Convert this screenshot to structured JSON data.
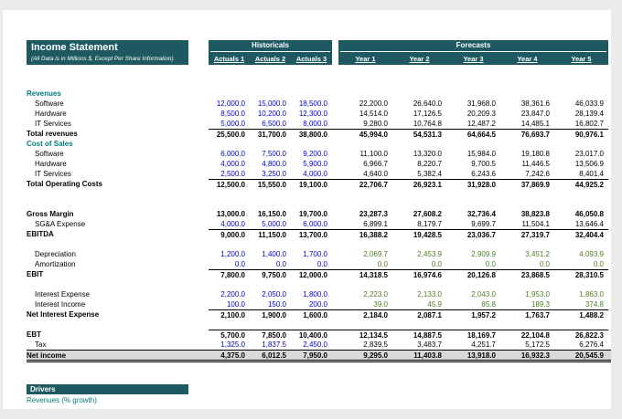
{
  "header": {
    "title": "Income Statement",
    "subtitle": "(All Data is in Millions $, Except Per Share Information)",
    "groups": {
      "historicals": "Historicals",
      "forecasts": "Forecasts"
    },
    "columns": [
      "Actuals 1",
      "Actuals 2",
      "Actuals 3",
      "Year 1",
      "Year 2",
      "Year 3",
      "Year 4",
      "Year 5"
    ]
  },
  "colors": {
    "banner": "#1E5962",
    "section": "#007C7C",
    "blue": "#0000CC",
    "green": "#4A7D23",
    "netbg": "#D9D9D9"
  },
  "table": {
    "rows": [
      {
        "type": "section",
        "label": "Revenues"
      },
      {
        "type": "item",
        "label": "Software",
        "hist": "blue",
        "fcst": "black",
        "values": [
          "12,000.0",
          "15,000.0",
          "18,500.0",
          "22,200.0",
          "26,640.0",
          "31,968.0",
          "38,361.6",
          "46,033.9"
        ]
      },
      {
        "type": "item",
        "label": "Hardware",
        "hist": "blue",
        "fcst": "black",
        "values": [
          "8,500.0",
          "10,200.0",
          "12,300.0",
          "14,514.0",
          "17,126.5",
          "20,209.3",
          "23,847.0",
          "28,139.4"
        ]
      },
      {
        "type": "item",
        "label": "IT Services",
        "hist": "blue",
        "fcst": "black",
        "values": [
          "5,000.0",
          "6,500.0",
          "8,000.0",
          "9,280.0",
          "10,764.8",
          "12,487.2",
          "14,485.1",
          "16,802.7"
        ]
      },
      {
        "type": "total",
        "label": "Total revenues",
        "border": true,
        "hist": "black",
        "fcst": "black",
        "values": [
          "25,500.0",
          "31,700.0",
          "38,800.0",
          "45,994.0",
          "54,531.3",
          "64,664.5",
          "76,693.7",
          "90,976.1"
        ]
      },
      {
        "type": "section",
        "label": "Cost of Sales"
      },
      {
        "type": "item",
        "label": "Software",
        "hist": "blue",
        "fcst": "black",
        "values": [
          "6,000.0",
          "7,500.0",
          "9,200.0",
          "11,100.0",
          "13,320.0",
          "15,984.0",
          "19,180.8",
          "23,017.0"
        ]
      },
      {
        "type": "item",
        "label": "Hardware",
        "hist": "blue",
        "fcst": "black",
        "values": [
          "4,000.0",
          "4,800.0",
          "5,900.0",
          "6,966.7",
          "8,220.7",
          "9,700.5",
          "11,446.5",
          "13,506.9"
        ]
      },
      {
        "type": "item",
        "label": "IT Services",
        "hist": "blue",
        "fcst": "black",
        "values": [
          "2,500.0",
          "3,250.0",
          "4,000.0",
          "4,640.0",
          "5,382.4",
          "6,243.6",
          "7,242.6",
          "8,401.4"
        ]
      },
      {
        "type": "total",
        "label": "Total Operating Costs",
        "border": true,
        "hist": "black",
        "fcst": "black",
        "values": [
          "12,500.0",
          "15,550.0",
          "19,100.0",
          "22,706.7",
          "26,923.1",
          "31,928.0",
          "37,869.9",
          "44,925.2"
        ]
      },
      {
        "type": "spacer"
      },
      {
        "type": "spacer"
      },
      {
        "type": "total",
        "label": "Gross Margin",
        "border": false,
        "hist": "black",
        "fcst": "black",
        "values": [
          "13,000.0",
          "16,150.0",
          "19,700.0",
          "23,287.3",
          "27,608.2",
          "32,736.4",
          "38,823.8",
          "46,050.8"
        ]
      },
      {
        "type": "item",
        "label": "SG&A Expense",
        "hist": "blue",
        "fcst": "black",
        "values": [
          "4,000.0",
          "5,000.0",
          "6,000.0",
          "6,899.1",
          "8,179.7",
          "9,699.7",
          "11,504.1",
          "13,646.4"
        ]
      },
      {
        "type": "total",
        "label": "EBITDA",
        "border": true,
        "hist": "black",
        "fcst": "black",
        "values": [
          "9,000.0",
          "11,150.0",
          "13,700.0",
          "16,388.2",
          "19,428.5",
          "23,036.7",
          "27,319.7",
          "32,404.4"
        ]
      },
      {
        "type": "spacer"
      },
      {
        "type": "item",
        "label": "Depreciation",
        "hist": "blue",
        "fcst": "green",
        "values": [
          "1,200.0",
          "1,400.0",
          "1,700.0",
          "2,069.7",
          "2,453.9",
          "2,909.9",
          "3,451.2",
          "4,093.9"
        ]
      },
      {
        "type": "item",
        "label": "Amortization",
        "hist": "blue",
        "fcst": "green",
        "values": [
          "0.0",
          "0.0",
          "0.0",
          "0.0",
          "0.0",
          "0.0",
          "0.0",
          "0.0"
        ]
      },
      {
        "type": "total",
        "label": "EBIT",
        "border": true,
        "hist": "black",
        "fcst": "black",
        "values": [
          "7,800.0",
          "9,750.0",
          "12,000.0",
          "14,318.5",
          "16,974.6",
          "20,126.8",
          "23,868.5",
          "28,310.5"
        ]
      },
      {
        "type": "spacer"
      },
      {
        "type": "item",
        "label": "Interest Expense",
        "hist": "blue",
        "fcst": "green",
        "values": [
          "2,200.0",
          "2,050.0",
          "1,800.0",
          "2,223.0",
          "2,133.0",
          "2,043.0",
          "1,953.0",
          "1,863.0"
        ]
      },
      {
        "type": "item",
        "label": "Interest Income",
        "hist": "blue",
        "fcst": "green",
        "values": [
          "100.0",
          "150.0",
          "200.0",
          "39.0",
          "45.9",
          "85.8",
          "189.3",
          "374.8"
        ]
      },
      {
        "type": "total",
        "label": "Net Interest Expense",
        "border": true,
        "hist": "black",
        "fcst": "black",
        "values": [
          "2,100.0",
          "1,900.0",
          "1,600.0",
          "2,184.0",
          "2,087.1",
          "1,957.2",
          "1,763.7",
          "1,488.2"
        ]
      },
      {
        "type": "spacer"
      },
      {
        "type": "total",
        "label": "EBT",
        "border": true,
        "hist": "black",
        "fcst": "black",
        "values": [
          "5,700.0",
          "7,850.0",
          "10,400.0",
          "12,134.5",
          "14,887.5",
          "18,169.7",
          "22,104.8",
          "26,822.3"
        ]
      },
      {
        "type": "item",
        "label": "Tax",
        "hist": "blue",
        "fcst": "black",
        "values": [
          "1,325.0",
          "1,837.5",
          "2,450.0",
          "2,839.5",
          "3,483.7",
          "4,251.7",
          "5,172.5",
          "6,276.4"
        ]
      },
      {
        "type": "net",
        "label": "Net income",
        "hist": "black",
        "fcst": "black",
        "values": [
          "4,375.0",
          "6,012.5",
          "7,950.0",
          "9,295.0",
          "11,403.8",
          "13,918.0",
          "16,932.3",
          "20,545.9"
        ]
      }
    ]
  },
  "drivers": {
    "title": "Drivers",
    "first_row_label": "Revenues (% growth)"
  }
}
